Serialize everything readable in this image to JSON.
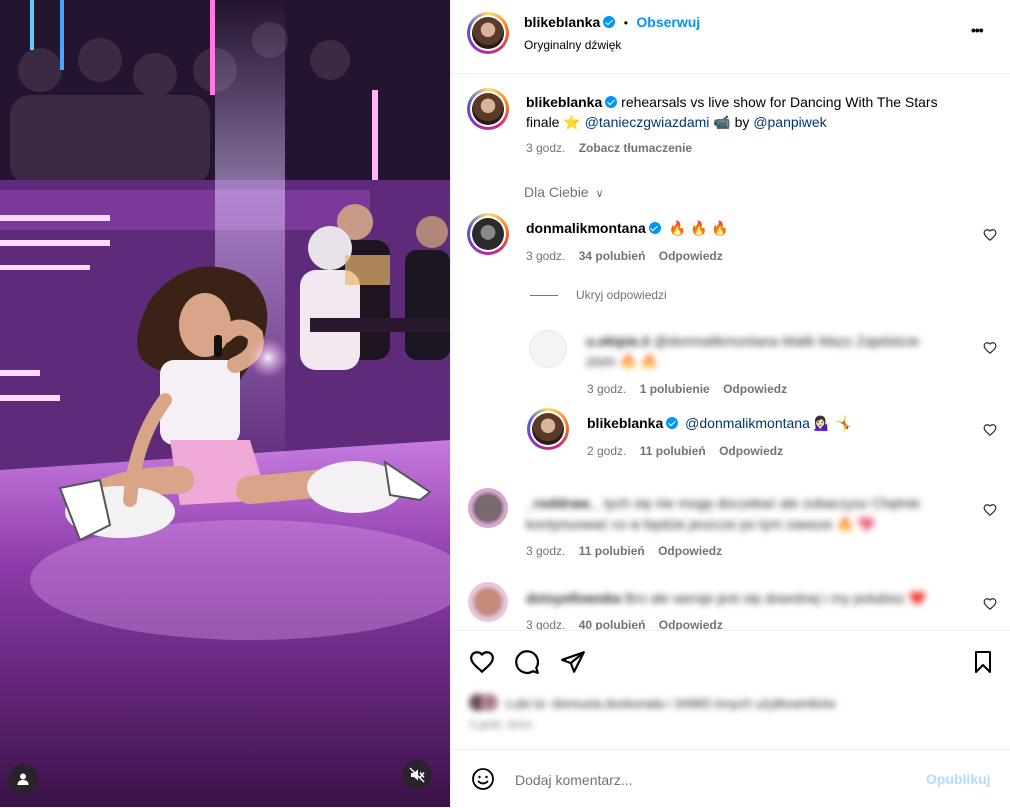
{
  "post": {
    "author": "blikeblanka",
    "follow_label": "Obserwuj",
    "separator": "•",
    "audio": "Oryginalny dźwięk",
    "more_label": "•••"
  },
  "caption": {
    "author": "blikeblanka",
    "text_1": "rehearsals vs live show for Dancing With The Stars",
    "text_2": "finale",
    "emoji_star": "⭐",
    "mention_1": "@tanieczgwiazdami",
    "emoji_2": "📹",
    "by": "by",
    "mention_2": "@panpiwek",
    "time": "3 godz.",
    "translate": "Zobacz tłumaczenie"
  },
  "for_you": {
    "label": "Dla Ciebie",
    "chevron": "∨"
  },
  "comments": [
    {
      "author": "donmalikmontana",
      "text": "🔥 🔥 🔥",
      "time": "3 godz.",
      "likes": "34 polubień",
      "reply": "Odpowiedz",
      "hide_replies": "Ukryj odpowiedzi",
      "replies": [
        {
          "author": "u.ekipie.ii",
          "text": "@donmalikmontana Malik Mazz Zajebiście ziom 🔥 🔥",
          "time": "3 godz.",
          "likes": "1 polubienie",
          "reply": "Odpowiedz"
        },
        {
          "author": "blikeblanka",
          "mention": "@donmalikmontana",
          "text": "💁🏻‍♀️ 🤸",
          "time": "2 godz.",
          "likes": "11 polubień",
          "reply": "Odpowiedz"
        }
      ]
    },
    {
      "author": "_roddraw._",
      "text_1": "tych się nie mogę doczekać ale zobaczysz Chętnie",
      "text_2": "kontynuować co w będzie jeszcze po tym zawsze 🔥 💖",
      "time": "3 godz.",
      "likes": "11 polubień",
      "reply": "Odpowiedz"
    },
    {
      "author": "doisyellowska",
      "text": "Bro ale wersje jest się dowolnej i my polubisz ❤️",
      "time": "3 godz.",
      "likes": "40 polubień",
      "reply": "Odpowiedz"
    }
  ],
  "likes_summary": {
    "text_1": "Lubi to: domusia.doskonala i 34983 innych użytkowników",
    "text_2": "3 godz. temu"
  },
  "add_comment": {
    "placeholder": "Dodaj komentarz...",
    "publish": "Opublikuj"
  },
  "colors": {
    "accent": "#0095f6",
    "mention": "#00376b",
    "muted": "#737373",
    "publish_disabled": "#b3dbff"
  },
  "icons": [
    "user-tag-icon",
    "mute-icon",
    "more-icon",
    "heart-icon",
    "comment-icon",
    "share-icon",
    "bookmark-icon",
    "emoji-icon",
    "chevron-down-icon",
    "verified-icon"
  ]
}
